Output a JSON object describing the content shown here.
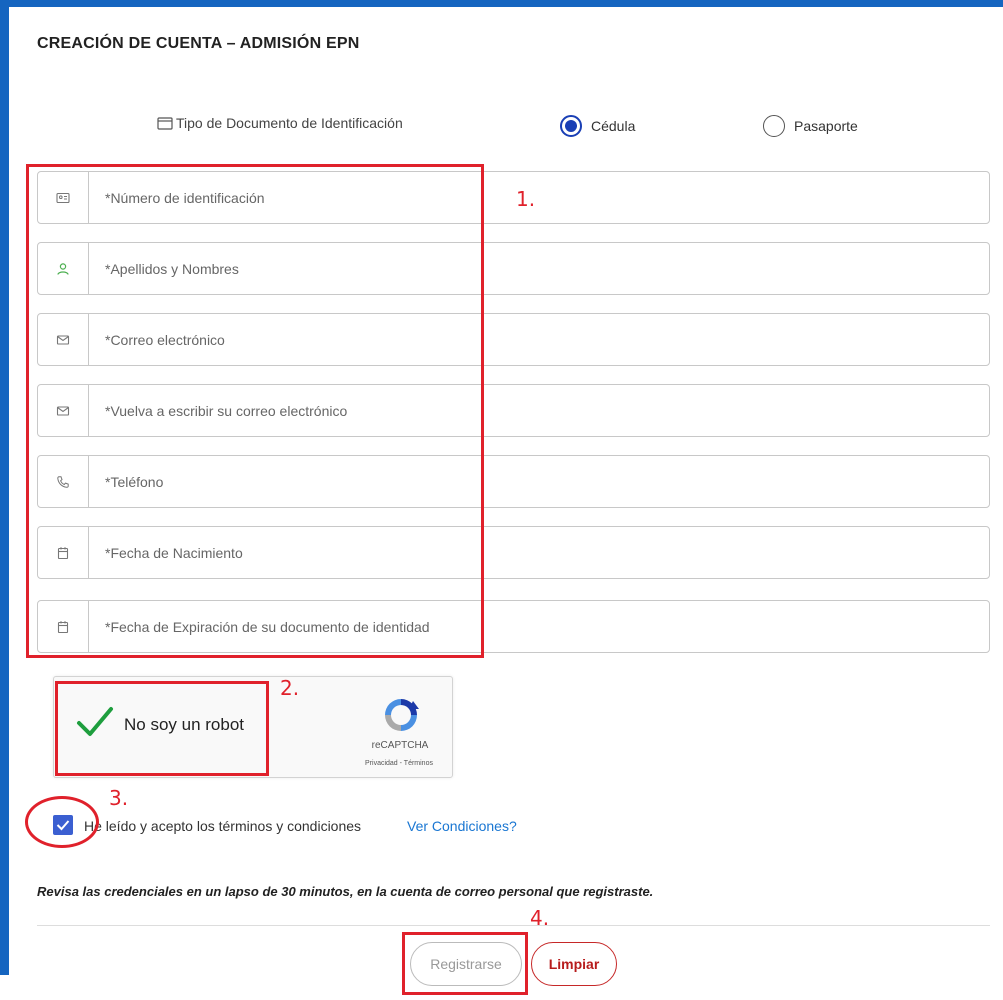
{
  "title": "CREACIÓN DE CUENTA – ADMISIÓN EPN",
  "doc_type": {
    "label": "Tipo de Documento de Identificación",
    "options": [
      {
        "label": "Cédula",
        "selected": true
      },
      {
        "label": "Pasaporte",
        "selected": false
      }
    ]
  },
  "fields": [
    {
      "placeholder": "*Número de identificación",
      "icon": "id-card-icon"
    },
    {
      "placeholder": "*Apellidos y Nombres",
      "icon": "user-icon"
    },
    {
      "placeholder": "*Correo electrónico",
      "icon": "envelope-icon"
    },
    {
      "placeholder": "*Vuelva a escribir su correo electrónico",
      "icon": "envelope-icon"
    },
    {
      "placeholder": "*Teléfono",
      "icon": "phone-icon"
    },
    {
      "placeholder": "*Fecha de Nacimiento",
      "icon": "calendar-icon"
    },
    {
      "placeholder": "*Fecha de Expiración de su documento de identidad",
      "icon": "calendar-icon"
    }
  ],
  "recaptcha": {
    "label": "No soy un robot",
    "brand": "reCAPTCHA",
    "links": "Privacidad - Términos",
    "checked": true
  },
  "terms": {
    "checked": true,
    "text": "He leído y acepto los términos y condiciones",
    "link": "Ver Condiciones?"
  },
  "note": "Revisa las credenciales en un lapso de 30 minutos, en la cuenta de correo personal que registraste.",
  "buttons": {
    "register": "Registrarse",
    "clear": "Limpiar"
  },
  "annotations": [
    "1.",
    "2.",
    "3.",
    "4."
  ],
  "colors": {
    "accent": "#1565c0",
    "annotation_red": "#e0212b",
    "link": "#1976d2",
    "radio": "#1a3fb5"
  }
}
